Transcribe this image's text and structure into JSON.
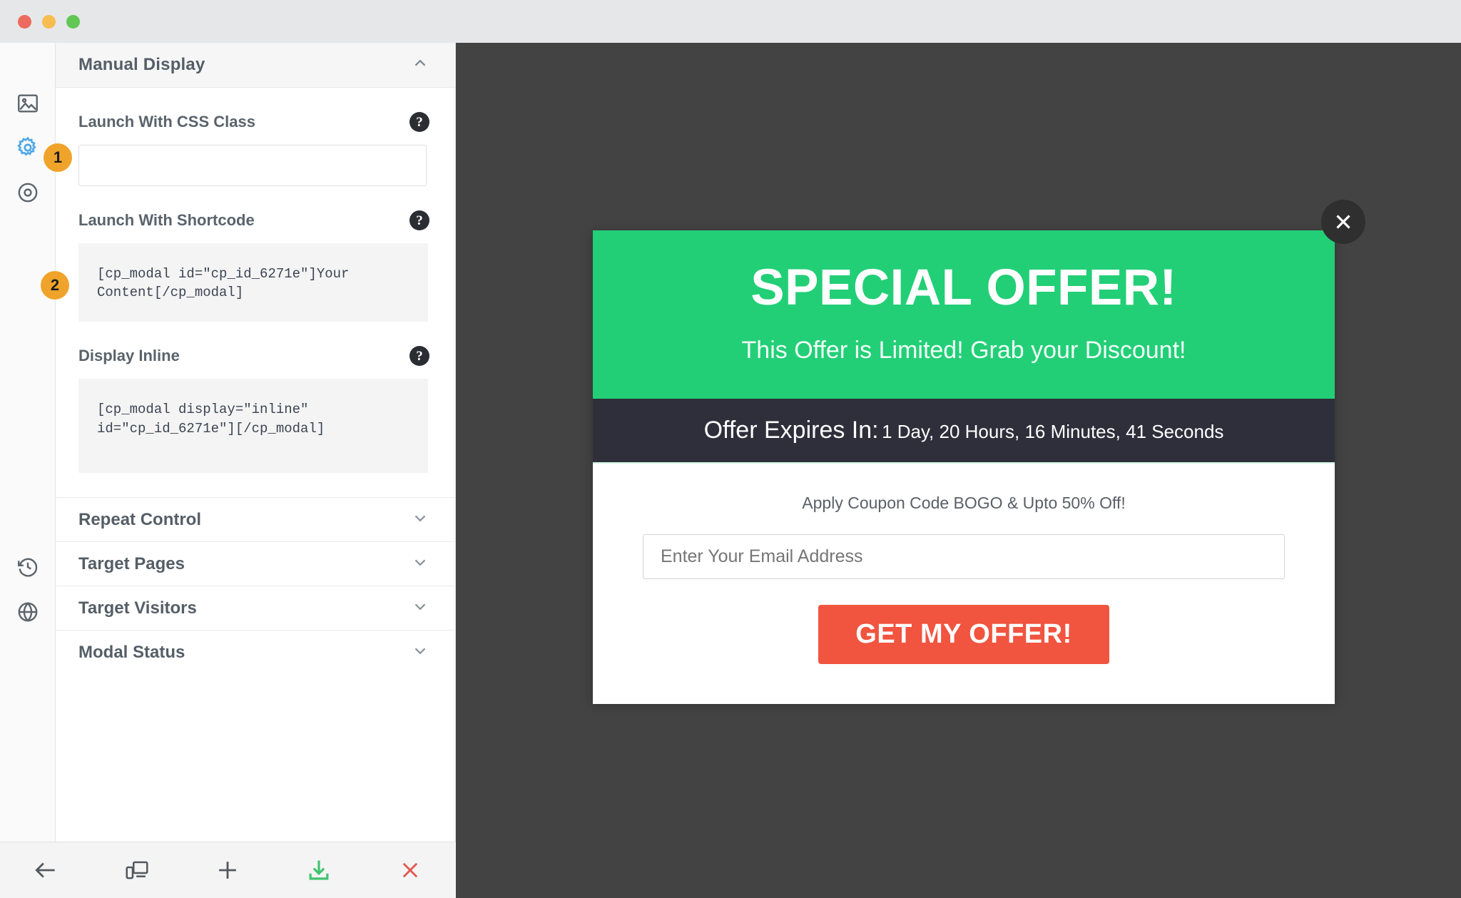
{
  "window": {
    "controls": [
      "close",
      "minimize",
      "maximize"
    ]
  },
  "icon_rail": {
    "items": [
      {
        "name": "image-icon",
        "active": false
      },
      {
        "name": "gear-icon",
        "active": true
      },
      {
        "name": "target-icon",
        "active": false
      },
      {
        "name": "history-icon",
        "active": false
      },
      {
        "name": "globe-icon",
        "active": false
      }
    ]
  },
  "panel": {
    "header": {
      "title": "Manual Display",
      "toggle": "chevron-up-icon"
    },
    "fields": [
      {
        "step": "1",
        "label": "Launch With CSS Class",
        "help": "?",
        "input_value": "",
        "input_placeholder": ""
      },
      {
        "step": "2",
        "label": "Launch With Shortcode",
        "help": "?",
        "code": "[cp_modal id=\"cp_id_6271e\"]Your Content[/cp_modal]"
      },
      {
        "step": "",
        "label": "Display Inline",
        "help": "?",
        "code": "[cp_modal display=\"inline\" id=\"cp_id_6271e\"][/cp_modal]"
      }
    ],
    "accordion": [
      {
        "label": "Repeat Control",
        "toggle": "chevron-down-icon"
      },
      {
        "label": "Target Pages",
        "toggle": "chevron-down-icon"
      },
      {
        "label": "Target Visitors",
        "toggle": "chevron-down-icon"
      },
      {
        "label": "Modal Status",
        "toggle": "chevron-down-icon"
      }
    ]
  },
  "toolbar": {
    "buttons": [
      {
        "name": "back-arrow-icon",
        "color": "#53585e"
      },
      {
        "name": "responsive-preview-icon",
        "color": "#53585e"
      },
      {
        "name": "add-plus-icon",
        "color": "#53585e"
      },
      {
        "name": "save-download-icon",
        "color": "#3ec46d"
      },
      {
        "name": "close-x-icon",
        "color": "#e2584d"
      }
    ]
  },
  "preview": {
    "background_color": "#434343",
    "modal": {
      "close_label": "×",
      "title": "SPECIAL OFFER!",
      "subtitle": "This Offer is Limited! Grab your Discount!",
      "timer_label": "Offer Expires In:",
      "timer_value": "1 Day, 20 Hours, 16 Minutes, 41 Seconds",
      "coupon_text": "Apply Coupon Code BOGO & Upto 50% Off!",
      "email_placeholder": "Enter Your Email Address",
      "email_value": "",
      "cta_label": "GET MY OFFER!",
      "colors": {
        "header_bg": "#22cf76",
        "timer_bg": "#2e2f3a",
        "cta_bg": "#f1543f",
        "body_bg": "#ffffff"
      }
    }
  }
}
